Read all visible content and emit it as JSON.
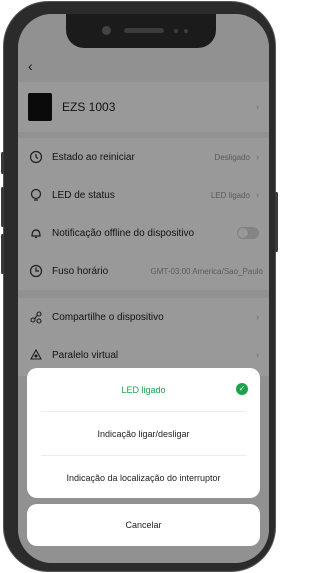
{
  "nav": {
    "back_glyph": "‹"
  },
  "device": {
    "name": "EZS 1003"
  },
  "settings": [
    {
      "icon": "restart-icon",
      "label": "Estado ao reiniciar",
      "value": "Desligado",
      "type": "chevron"
    },
    {
      "icon": "led-icon",
      "label": "LED de status",
      "value": "LED ligado",
      "type": "chevron"
    },
    {
      "icon": "notification-icon",
      "label": "Notificação offline do dispositivo",
      "value": "",
      "type": "toggle",
      "toggle_on": false
    },
    {
      "icon": "timezone-icon",
      "label": "Fuso horário",
      "value": "GMT-03:00 America/Sao_Paulo",
      "type": "none"
    },
    {
      "icon": "share-icon",
      "label": "Compartilhe o dispositivo",
      "value": "",
      "type": "chevron"
    },
    {
      "icon": "virtual-icon",
      "label": "Paralelo virtual",
      "value": "",
      "type": "chevron"
    }
  ],
  "sheet": {
    "options": [
      {
        "label": "LED ligado",
        "selected": true
      },
      {
        "label": "Indicação ligar/desligar",
        "selected": false
      },
      {
        "label": "Indicação da localização do interruptor",
        "selected": false
      }
    ],
    "cancel_label": "Cancelar"
  },
  "colors": {
    "accent": "#1aa34a",
    "overlay": "rgba(0,0,0,0.40)"
  }
}
